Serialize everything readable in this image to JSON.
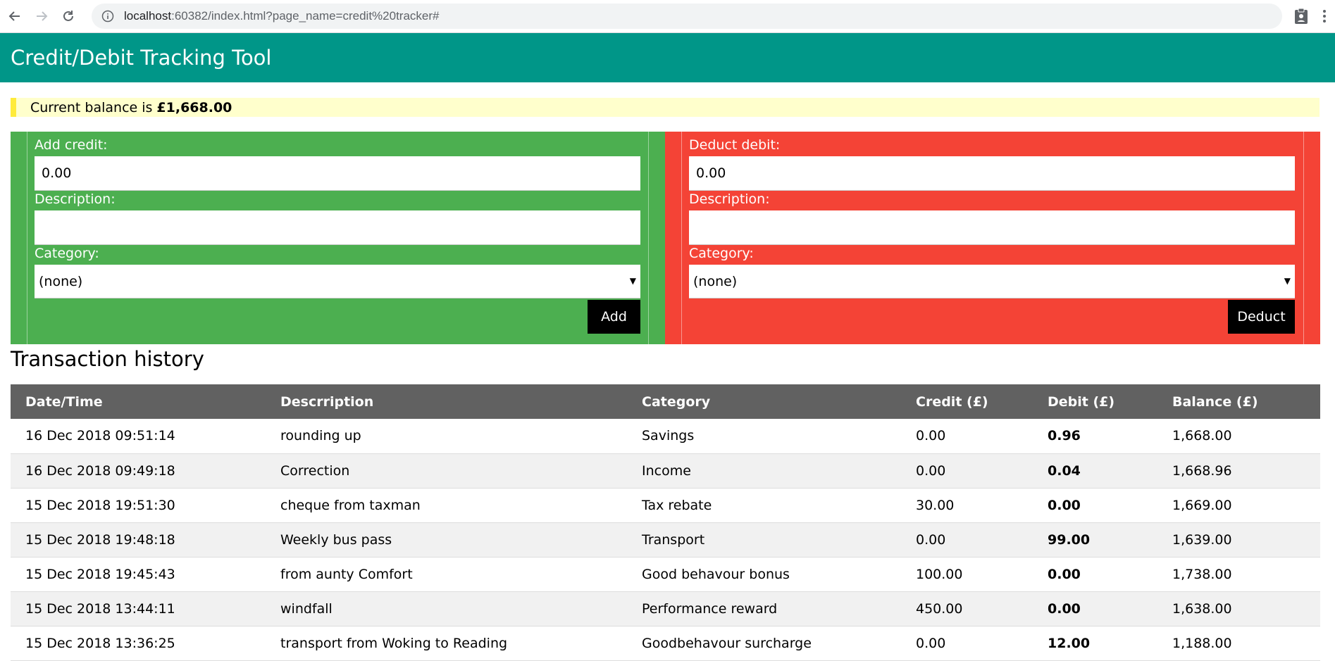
{
  "browser": {
    "url_host": "localhost",
    "url_rest": ":60382/index.html?page_name=credit%20tracker#"
  },
  "header": {
    "title": "Credit/Debit Tracking Tool"
  },
  "balance": {
    "prefix": "Current balance is",
    "amount": "£1,668.00"
  },
  "credit_form": {
    "amount_label": "Add credit:",
    "amount_value": "0.00",
    "description_label": "Description:",
    "description_value": "",
    "category_label": "Category:",
    "category_value": "(none)",
    "button_label": "Add"
  },
  "debit_form": {
    "amount_label": "Deduct debit:",
    "amount_value": "0.00",
    "description_label": "Description:",
    "description_value": "",
    "category_label": "Category:",
    "category_value": "(none)",
    "button_label": "Deduct"
  },
  "history": {
    "title": "Transaction history",
    "columns": [
      "Date/Time",
      "Descrription",
      "Category",
      "Credit (£)",
      "Debit (£)",
      "Balance (£)"
    ],
    "rows": [
      [
        "16 Dec 2018 09:51:14",
        "rounding up",
        "Savings",
        "0.00",
        "0.96",
        "1,668.00"
      ],
      [
        "16 Dec 2018 09:49:18",
        "Correction",
        "Income",
        "0.00",
        "0.04",
        "1,668.96"
      ],
      [
        "15 Dec 2018 19:51:30",
        "cheque from taxman",
        "Tax rebate",
        "30.00",
        "0.00",
        "1,669.00"
      ],
      [
        "15 Dec 2018 19:48:18",
        "Weekly bus pass",
        "Transport",
        "0.00",
        "99.00",
        "1,639.00"
      ],
      [
        "15 Dec 2018 19:45:43",
        "from aunty Comfort",
        "Good behavour bonus",
        "100.00",
        "0.00",
        "1,738.00"
      ],
      [
        "15 Dec 2018 13:44:11",
        "windfall",
        "Performance reward",
        "450.00",
        "0.00",
        "1,638.00"
      ],
      [
        "15 Dec 2018 13:36:25",
        "transport from Woking to Reading",
        "Goodbehavour surcharge",
        "0.00",
        "12.00",
        "1,188.00"
      ]
    ]
  }
}
